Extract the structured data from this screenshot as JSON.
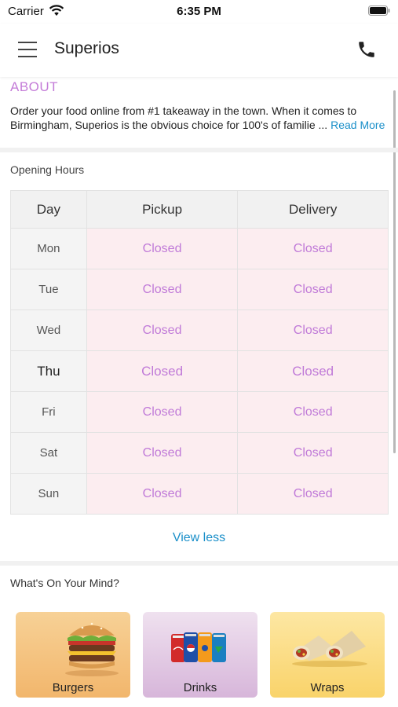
{
  "status_bar": {
    "carrier": "Carrier",
    "time": "6:35 PM"
  },
  "header": {
    "title": "Superios",
    "menu_icon": "hamburger-menu-icon",
    "call_icon": "phone-icon"
  },
  "about": {
    "title": "ABOUT",
    "text": "Order your food online from #1 takeaway in the town. When it comes to Birmingham, Superios is the obvious choice for 100's of familie ...",
    "read_more": "Read More"
  },
  "opening_hours": {
    "title": "Opening Hours",
    "columns": [
      "Day",
      "Pickup",
      "Delivery"
    ],
    "rows": [
      {
        "day": "Mon",
        "pickup": "Closed",
        "delivery": "Closed"
      },
      {
        "day": "Tue",
        "pickup": "Closed",
        "delivery": "Closed"
      },
      {
        "day": "Wed",
        "pickup": "Closed",
        "delivery": "Closed"
      },
      {
        "day": "Thu",
        "pickup": "Closed",
        "delivery": "Closed"
      },
      {
        "day": "Fri",
        "pickup": "Closed",
        "delivery": "Closed"
      },
      {
        "day": "Sat",
        "pickup": "Closed",
        "delivery": "Closed"
      },
      {
        "day": "Sun",
        "pickup": "Closed",
        "delivery": "Closed"
      }
    ],
    "today": "Thu",
    "view_less": "View less"
  },
  "whats_on_your_mind": {
    "title": "What's On Your Mind?",
    "categories": [
      {
        "label": "Burgers",
        "icon": "burger-icon"
      },
      {
        "label": "Drinks",
        "icon": "soda-cans-icon"
      },
      {
        "label": "Wraps",
        "icon": "wrap-icon"
      }
    ]
  },
  "colors": {
    "accent_purple": "#c47cd8",
    "link_blue": "#1a8fc9",
    "closed_bg": "#fcedf0"
  }
}
